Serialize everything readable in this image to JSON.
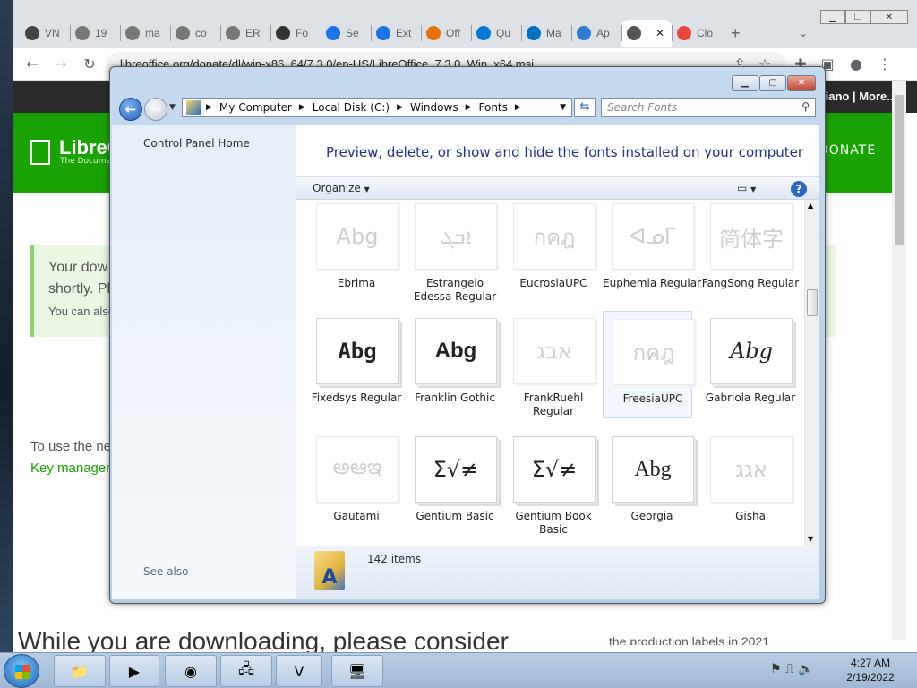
{
  "browser": {
    "tabs": [
      {
        "label": "VN",
        "active": false
      },
      {
        "label": "19",
        "active": false
      },
      {
        "label": "ma",
        "active": false
      },
      {
        "label": "co",
        "active": false
      },
      {
        "label": "ER",
        "active": false
      },
      {
        "label": "Fo",
        "active": false
      },
      {
        "label": "Se",
        "active": false
      },
      {
        "label": "Ext",
        "active": false
      },
      {
        "label": "Off",
        "active": false
      },
      {
        "label": "Qu",
        "active": false
      },
      {
        "label": "Ma",
        "active": false
      },
      {
        "label": "Ap",
        "active": false
      },
      {
        "label": "",
        "active": true
      },
      {
        "label": "Clo",
        "active": false
      }
    ],
    "new_tab": "+",
    "url": "libreoffice.org/donate/dl/win-x86_64/7.3.0/en-US/LibreOffice_7.3.0_Win_x64.msi"
  },
  "page": {
    "topbar_right": "liano | More...",
    "logo": "LibreO",
    "logo_sub": "The Documen",
    "donate": "DONATE",
    "notice_line1": "Your dow",
    "notice_line2": "shortly. Pl",
    "notice_line3": "You can also",
    "use_text": "To use the ne",
    "key_link": "Key manager",
    "bottom_left": "While you are downloading, please consider",
    "bottom_right": "the production labels in 2021"
  },
  "explorer": {
    "breadcrumb": [
      "My Computer",
      "Local Disk (C:)",
      "Windows",
      "Fonts"
    ],
    "search_placeholder": "Search Fonts",
    "nav_home": "Control Panel Home",
    "see_also": "See also",
    "header": "Preview, delete, or show and hide the fonts installed on your computer",
    "organize": "Organize",
    "status_count": "142 items",
    "fonts": [
      {
        "name": "Ebrima",
        "preview": "Abg",
        "faded": true
      },
      {
        "name": "Estrangelo Edessa Regular",
        "preview": "ܐܒܓ",
        "faded": true
      },
      {
        "name": "EucrosiaUPC",
        "preview": "กคฎ",
        "faded": true
      },
      {
        "name": "Euphemia Regular",
        "preview": "ᐊᓄᒥ",
        "faded": true
      },
      {
        "name": "FangSong Regular",
        "preview": "简体字",
        "faded": true
      },
      {
        "name": "Fixedsys Regular",
        "preview": "Abg",
        "faded": false
      },
      {
        "name": "Franklin Gothic",
        "preview": "Abg",
        "faded": false
      },
      {
        "name": "FrankRuehl Regular",
        "preview": "אבג",
        "faded": true
      },
      {
        "name": "FreesiaUPC",
        "preview": "กคฎ",
        "faded": true
      },
      {
        "name": "Gabriola Regular",
        "preview": "Abg",
        "faded": false
      },
      {
        "name": "Gautami",
        "preview": "అఆఇ",
        "faded": true
      },
      {
        "name": "Gentium Basic",
        "preview": "Σ√≠",
        "faded": false
      },
      {
        "name": "Gentium Book Basic",
        "preview": "Σ√≠",
        "faded": false
      },
      {
        "name": "Georgia",
        "preview": "Abg",
        "faded": false
      },
      {
        "name": "Gisha",
        "preview": "אגג",
        "faded": true
      }
    ]
  },
  "taskbar": {
    "time": "4:27 AM",
    "date": "2/19/2022"
  }
}
